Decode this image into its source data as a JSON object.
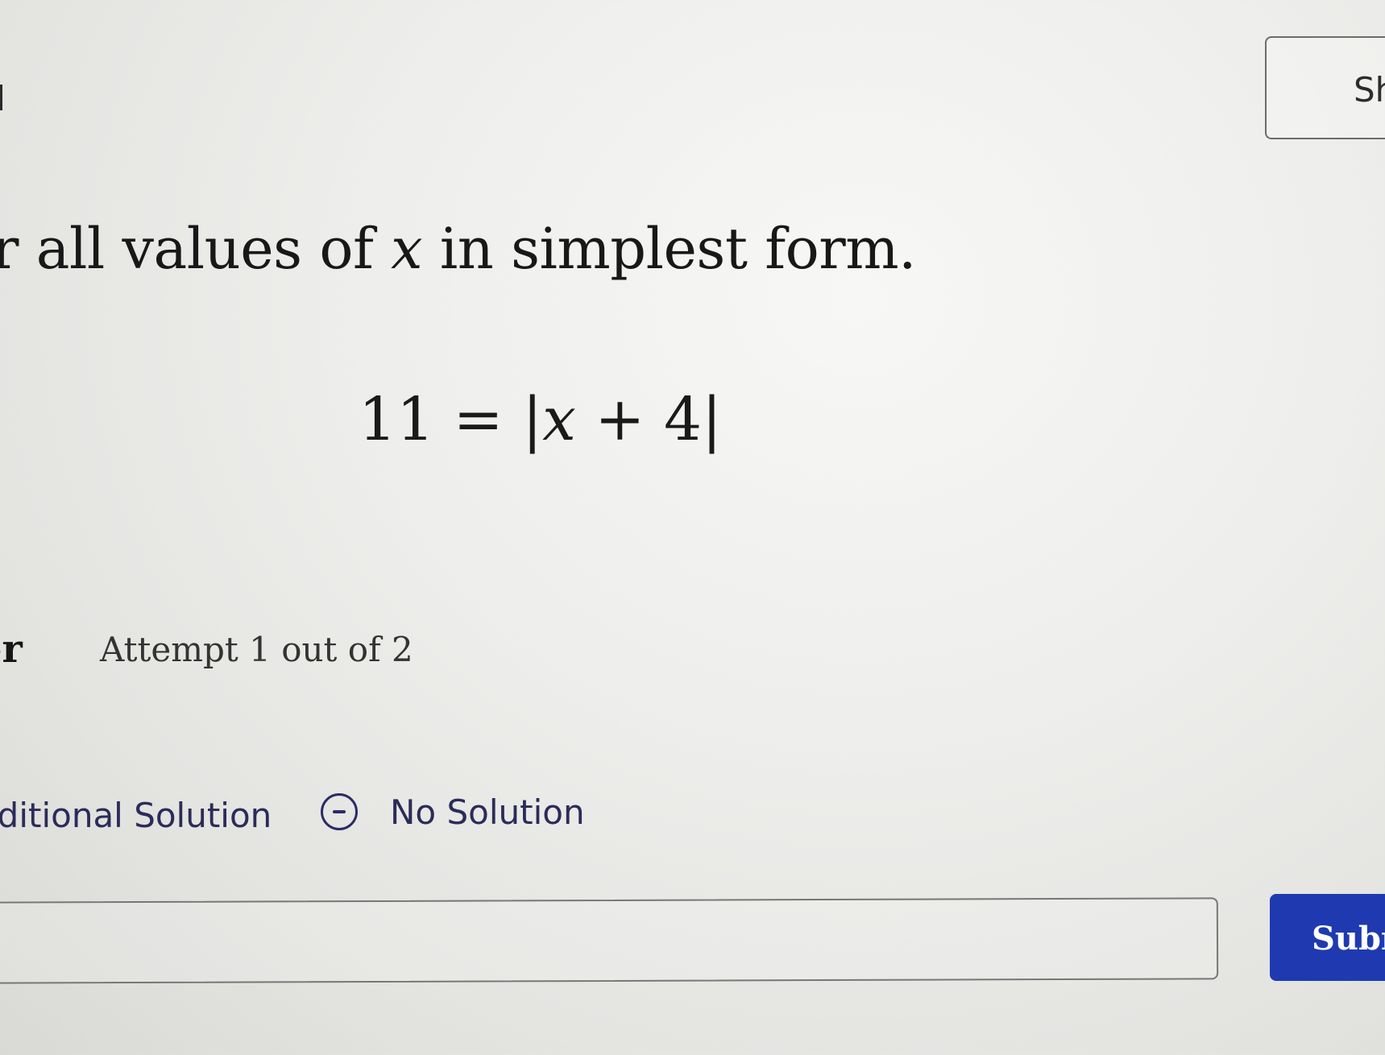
{
  "header": {
    "top_right_button_label": "Sh"
  },
  "question": {
    "prompt_before_var": "r all values of ",
    "prompt_var": "x",
    "prompt_after_var": " in simplest form.",
    "equation_left": "11 = |",
    "equation_var": "x",
    "equation_right": " + 4|"
  },
  "answer_section": {
    "header": "er",
    "attempt_text": "Attempt 1 out of 2",
    "add_solution_label": "dditional Solution",
    "no_solution_label": "No Solution",
    "input_value": "",
    "submit_label": "Subr"
  },
  "colors": {
    "submit_background": "#1f3ab0",
    "link_text": "#2b2b5a"
  },
  "icons": {
    "no_solution": "circle-minus-icon"
  }
}
